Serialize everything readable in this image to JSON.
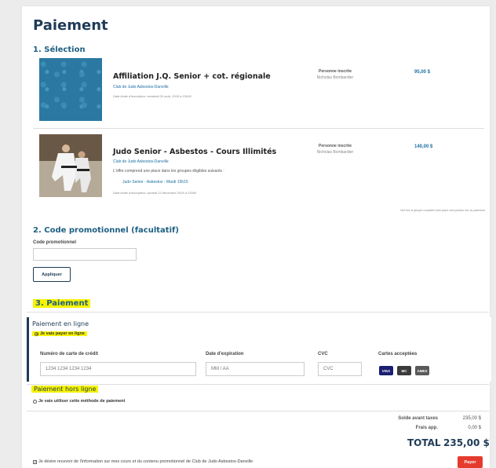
{
  "page": {
    "title": "Paiement"
  },
  "selection": {
    "heading": "1. Sélection",
    "items": [
      {
        "name": "Affiliation J.Q. Senior + cot. régionale",
        "club": "Club de Judo Asbestos-Danville",
        "deadline": "Date limite d'inscription: vendredi 30 août, 2019 à 23h59",
        "person_label": "Personne inscrite",
        "person": "Nicholas Bombardier",
        "price": "95,00 $"
      },
      {
        "name": "Judo Senior - Asbestos - Cours Illimités",
        "club": "Club de Judo Asbestos-Danville",
        "offer_text": "L'offre comprend une place dans les groupes éligibles suivants :",
        "group": "Judo Senior - Asbestos - Mardi 19h15",
        "deadline": "Date limite d'inscription: samedi 22 décembre 2018 à 23h00",
        "person_label": "Personne inscrite",
        "person": "Nicholas Bombardier",
        "price": "140,00 $"
      }
    ],
    "note": "Une fois le groupe complété votre place sera perdue lors du paiement"
  },
  "promo": {
    "heading": "2. Code promotionnel (facultatif)",
    "label": "Code promotionnel",
    "value": "",
    "apply_label": "Appliquer"
  },
  "payment": {
    "heading": "3. Paiement",
    "online": {
      "title": "Paiement en ligne",
      "radio_label": "Je vais payer en ligne",
      "card_number_label": "Numéro de carte de crédit",
      "card_number_placeholder": "1234 1234 1234 1234",
      "expiry_label": "Date d'expiration",
      "expiry_placeholder": "MM / AA",
      "cvc_label": "CVC",
      "cvc_placeholder": "CVC",
      "accepted_label": "Cartes acceptées",
      "cards": [
        "VISA",
        "MC",
        "AMEX"
      ]
    },
    "offline": {
      "title": "Paiement hors ligne",
      "radio_label": "Je vais utiliser cette méthode de paiement"
    }
  },
  "summary": {
    "subtotal_label": "Solde avant taxes",
    "subtotal": "235,00 $",
    "fees_label": "Frais app.",
    "fees": "0,00 $",
    "total_label": "TOTAL",
    "total": "235,00 $"
  },
  "consent": {
    "label": "Je désire recevoir de l'information sur mes cours et du contenu promotionnel de Club de Judo Asbestos-Danville"
  },
  "pay_button": "Payer",
  "colors": {
    "primary": "#1f3b57",
    "link": "#1d6fa5",
    "highlight": "#f6f300",
    "pay": "#e53b2e"
  }
}
